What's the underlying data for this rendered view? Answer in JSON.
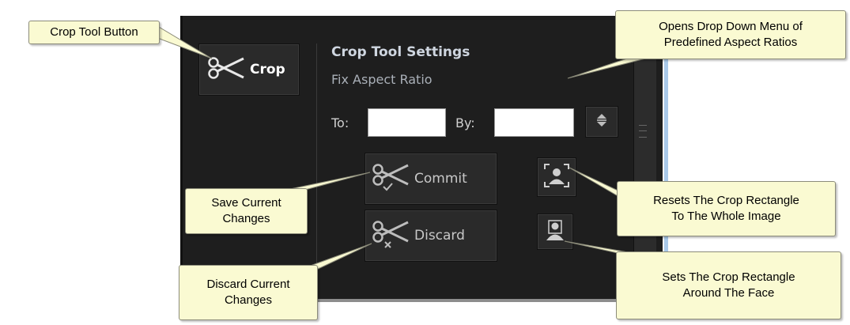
{
  "crop_button": {
    "label": "Crop",
    "icon": "scissors-icon"
  },
  "settings": {
    "title": "Crop Tool Settings",
    "subtitle": "Fix Aspect Ratio",
    "to_label": "To:",
    "to_value": "",
    "by_label": "By:",
    "by_value": "",
    "ratio_dropdown_icon": "up-down-arrows-icon"
  },
  "actions": {
    "commit_label": "Commit",
    "discard_label": "Discard",
    "reset_icon": "reset-crop-icon",
    "face_icon": "face-crop-icon"
  },
  "callouts": {
    "crop": "Crop Tool Button",
    "ratio_line1": "Opens Drop Down Menu of",
    "ratio_line2": "Predefined Aspect Ratios",
    "save_line1": "Save Current",
    "save_line2": "Changes",
    "reset_line1": "Resets The Crop Rectangle",
    "reset_line2": "To The Whole Image",
    "discard_line1": "Discard Current",
    "discard_line2": "Changes",
    "face_line1": "Sets The Crop Rectangle",
    "face_line2": "Around The Face"
  },
  "colors": {
    "panel_bg": "#1e1e1e",
    "callout_bg": "#fafad2",
    "frame_accent": "#a9c9ea"
  }
}
